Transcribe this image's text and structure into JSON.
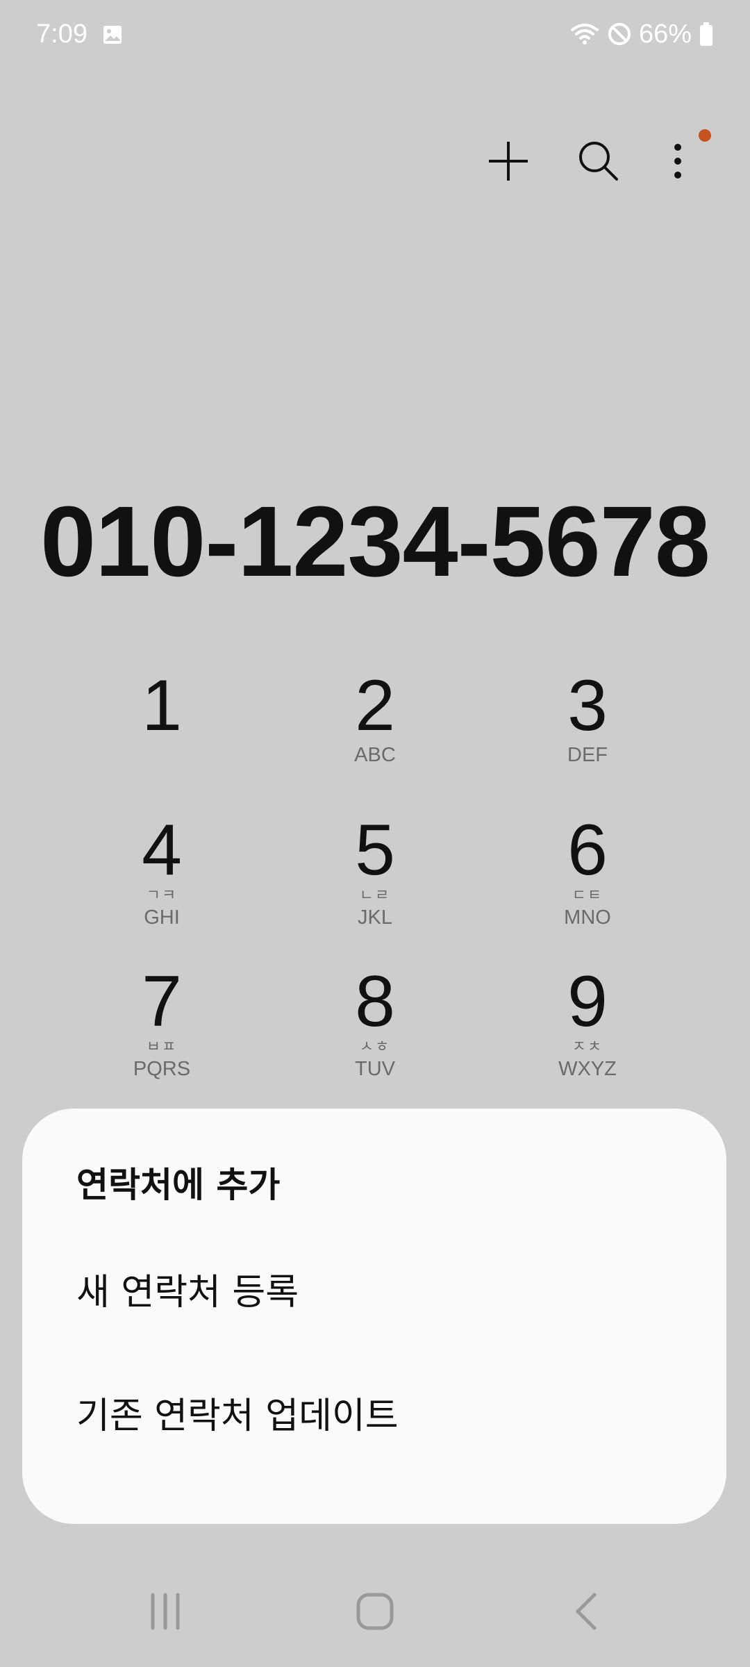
{
  "status_bar": {
    "time": "7:09",
    "battery": "66%",
    "icons": [
      "gallery-icon",
      "wifi-icon",
      "do-not-disturb-icon",
      "battery-icon"
    ]
  },
  "toolbar": {
    "icons": [
      "add-icon",
      "search-icon",
      "more-options-icon"
    ],
    "badge_color": "#c6521d"
  },
  "dialer": {
    "number": "010-1234-5678",
    "keys": [
      {
        "digit": "1",
        "jamo": "",
        "letters": ""
      },
      {
        "digit": "2",
        "jamo": "",
        "letters": "ABC"
      },
      {
        "digit": "3",
        "jamo": "",
        "letters": "DEF"
      },
      {
        "digit": "4",
        "jamo": "ㄱㅋ",
        "letters": "GHI"
      },
      {
        "digit": "5",
        "jamo": "ㄴㄹ",
        "letters": "JKL"
      },
      {
        "digit": "6",
        "jamo": "ㄷㅌ",
        "letters": "MNO"
      },
      {
        "digit": "7",
        "jamo": "ㅂㅍ",
        "letters": "PQRS"
      },
      {
        "digit": "8",
        "jamo": "ㅅㅎ",
        "letters": "TUV"
      },
      {
        "digit": "9",
        "jamo": "ㅈㅊ",
        "letters": "WXYZ"
      }
    ]
  },
  "sheet": {
    "title": "연락처에 추가",
    "items": [
      "새 연락처 등록",
      "기존 연락처 업데이트"
    ]
  },
  "navigation": {
    "icons": [
      "recent-apps-icon",
      "home-icon",
      "back-icon"
    ]
  }
}
